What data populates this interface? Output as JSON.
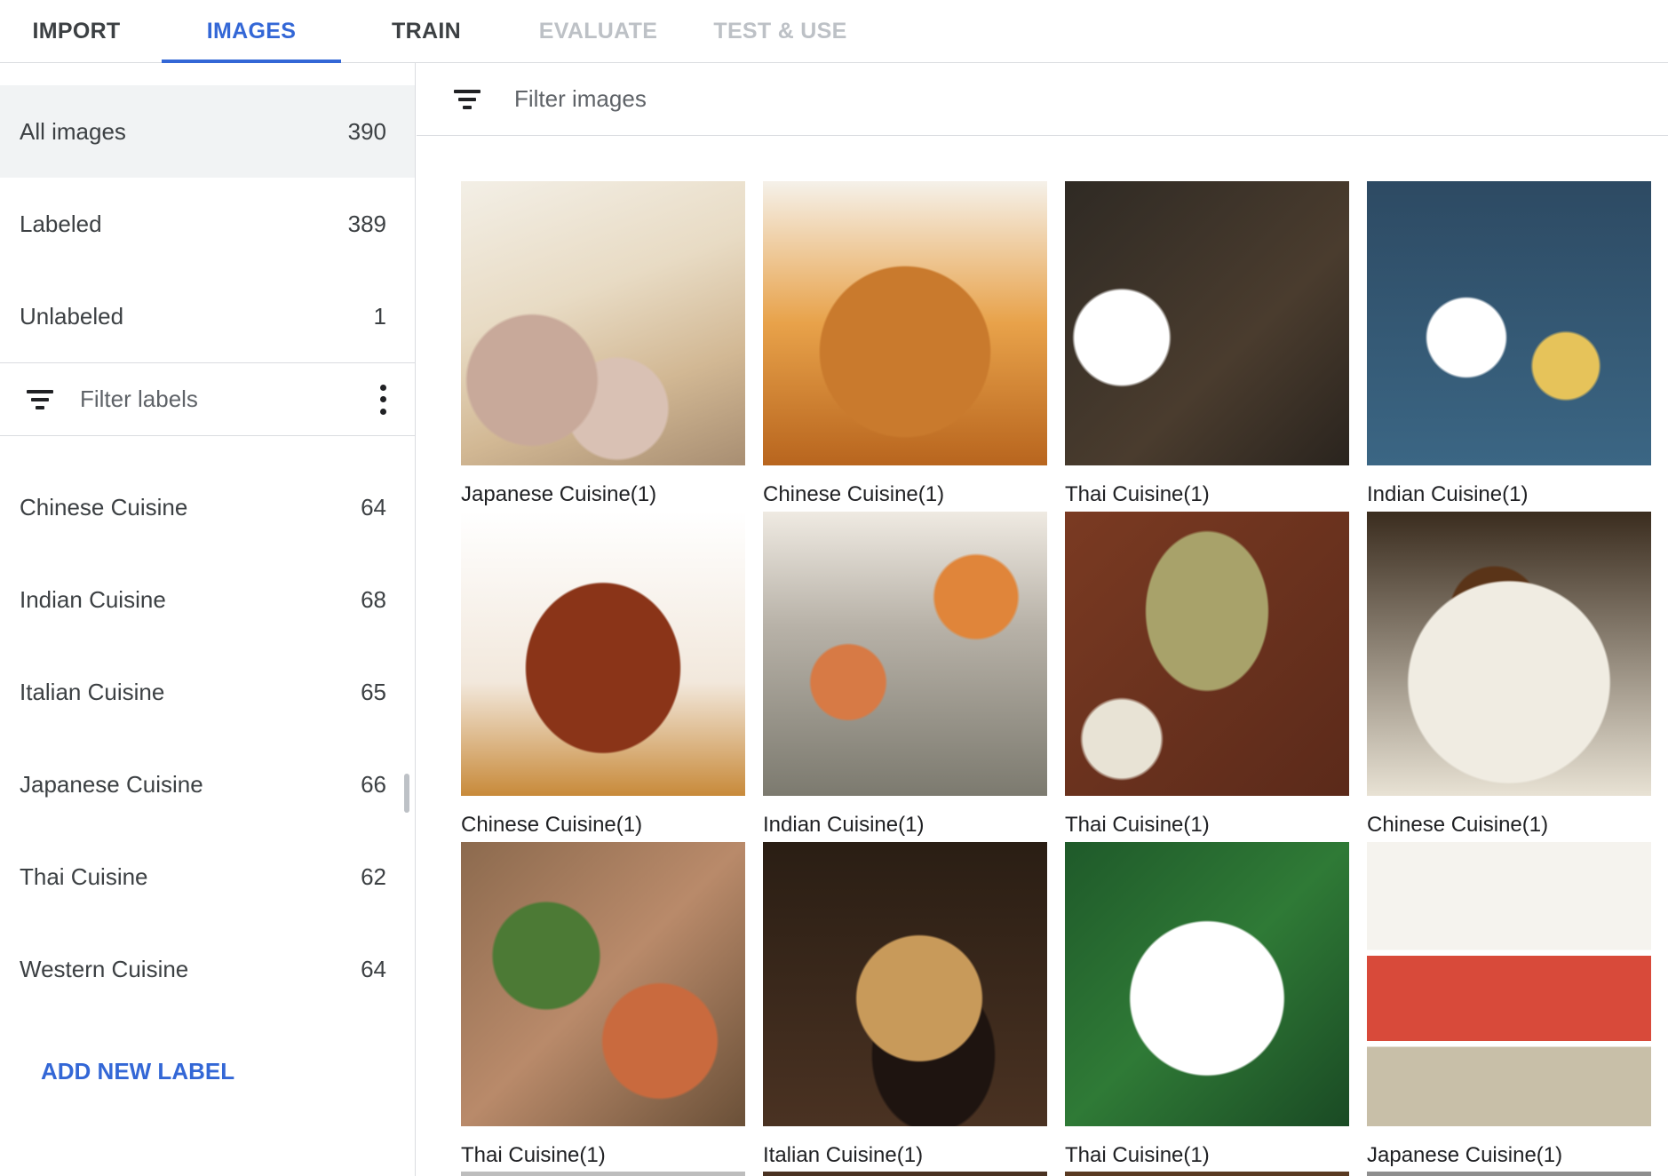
{
  "tabs": [
    {
      "label": "IMPORT",
      "state": "normal"
    },
    {
      "label": "IMAGES",
      "state": "active"
    },
    {
      "label": "TRAIN",
      "state": "normal"
    },
    {
      "label": "EVALUATE",
      "state": "disabled"
    },
    {
      "label": "TEST & USE",
      "state": "disabled"
    }
  ],
  "sidebar": {
    "summary": [
      {
        "label": "All images",
        "count": "390",
        "selected": true
      },
      {
        "label": "Labeled",
        "count": "389",
        "selected": false
      },
      {
        "label": "Unlabeled",
        "count": "1",
        "selected": false
      }
    ],
    "filter_labels_placeholder": "Filter labels",
    "labels": [
      {
        "label": "Chinese Cuisine",
        "count": "64"
      },
      {
        "label": "Indian Cuisine",
        "count": "68"
      },
      {
        "label": "Italian Cuisine",
        "count": "65"
      },
      {
        "label": "Japanese Cuisine",
        "count": "66"
      },
      {
        "label": "Thai Cuisine",
        "count": "62"
      },
      {
        "label": "Western Cuisine",
        "count": "64"
      }
    ],
    "add_label": "ADD NEW LABEL"
  },
  "main": {
    "filter_images_placeholder": "Filter images",
    "images": [
      {
        "caption": "Japanese Cuisine(1)"
      },
      {
        "caption": "Chinese Cuisine(1)"
      },
      {
        "caption": "Thai Cuisine(1)"
      },
      {
        "caption": "Indian Cuisine(1)"
      },
      {
        "caption": "Chinese Cuisine(1)"
      },
      {
        "caption": "Indian Cuisine(1)"
      },
      {
        "caption": "Thai Cuisine(1)"
      },
      {
        "caption": "Chinese Cuisine(1)"
      },
      {
        "caption": "Thai Cuisine(1)"
      },
      {
        "caption": "Italian Cuisine(1)"
      },
      {
        "caption": "Thai Cuisine(1)"
      },
      {
        "caption": "Japanese Cuisine(1)"
      }
    ]
  },
  "colors": {
    "accent": "#3367d6",
    "selected_row_bg": "#f1f3f4",
    "disabled_tab": "#bdc1c6",
    "divider": "#dadce0"
  },
  "icons": {
    "filter": "filter-list-icon",
    "more": "more-vert-icon"
  }
}
